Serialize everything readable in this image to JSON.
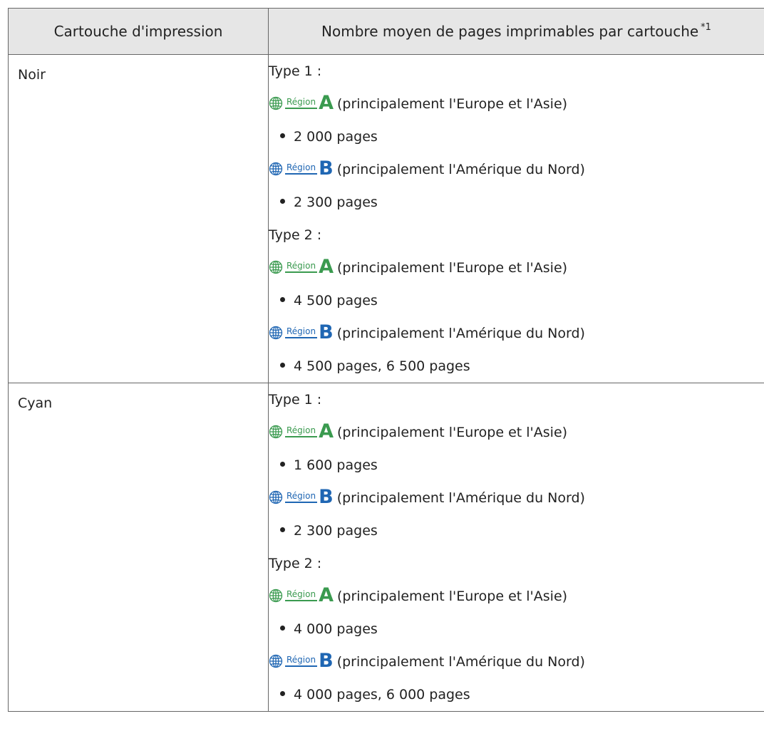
{
  "table": {
    "header": {
      "col1": "Cartouche d'impression",
      "col2": "Nombre moyen de pages imprimables par cartouche",
      "col2_note": "*1"
    },
    "region_word": "Région",
    "colors": {
      "region_a": "#3a9a4f",
      "region_b": "#1f66b3",
      "header_bg": "#e6e6e6",
      "border": "#666666"
    },
    "icons": {
      "region": "globe-icon",
      "bullet": "bullet-dot"
    },
    "rows": [
      {
        "cartridge": "Noir",
        "type1_label": "Type 1 :",
        "type1_a_letter": "A",
        "type1_a_desc": "(principalement l'Europe et l'Asie)",
        "type1_a_pages": "2 000 pages",
        "type1_b_letter": "B",
        "type1_b_desc": "(principalement l'Amérique du Nord)",
        "type1_b_pages": "2 300 pages",
        "type2_label": "Type 2 :",
        "type2_a_letter": "A",
        "type2_a_desc": "(principalement l'Europe et l'Asie)",
        "type2_a_pages": "4 500 pages",
        "type2_b_letter": "B",
        "type2_b_desc": "(principalement l'Amérique du Nord)",
        "type2_b_pages": "4 500 pages, 6 500 pages"
      },
      {
        "cartridge": "Cyan",
        "type1_label": "Type 1 :",
        "type1_a_letter": "A",
        "type1_a_desc": "(principalement l'Europe et l'Asie)",
        "type1_a_pages": "1 600 pages",
        "type1_b_letter": "B",
        "type1_b_desc": "(principalement l'Amérique du Nord)",
        "type1_b_pages": "2 300 pages",
        "type2_label": "Type 2 :",
        "type2_a_letter": "A",
        "type2_a_desc": "(principalement l'Europe et l'Asie)",
        "type2_a_pages": "4 000 pages",
        "type2_b_letter": "B",
        "type2_b_desc": "(principalement l'Amérique du Nord)",
        "type2_b_pages": "4 000 pages, 6 000 pages"
      }
    ]
  }
}
